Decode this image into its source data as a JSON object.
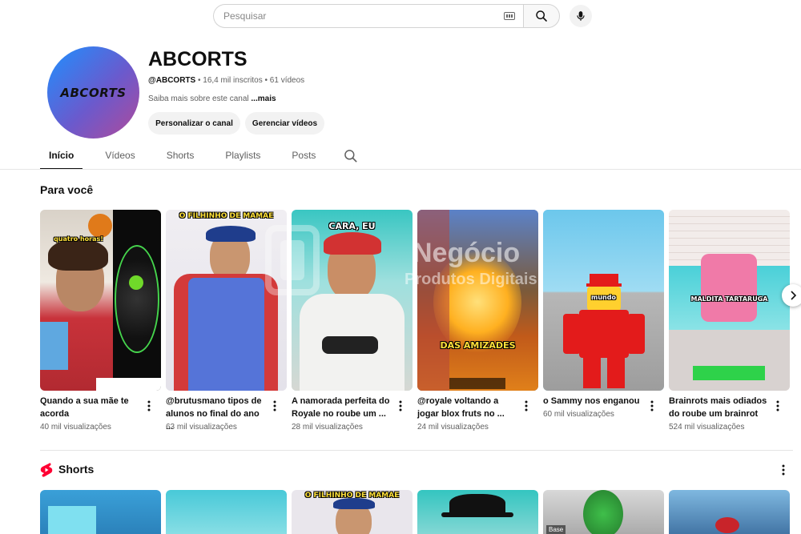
{
  "search": {
    "placeholder": "Pesquisar"
  },
  "channel": {
    "avatar_text": "ABCORTS",
    "name": "ABCORTS",
    "handle": "@ABCORTS",
    "subscribers": "16,4 mil inscritos",
    "videos": "61 vídeos",
    "about": "Saiba mais sobre este canal",
    "about_more": "...mais",
    "customize_label": "Personalizar o canal",
    "manage_label": "Gerenciar vídeos"
  },
  "tabs": [
    {
      "label": "Início",
      "active": true
    },
    {
      "label": "Vídeos",
      "active": false
    },
    {
      "label": "Shorts",
      "active": false
    },
    {
      "label": "Playlists",
      "active": false
    },
    {
      "label": "Posts",
      "active": false
    }
  ],
  "sections": {
    "for_you": "Para você",
    "shorts": "Shorts"
  },
  "videos": [
    {
      "title": "Quando a sua mãe te acorda",
      "views": "40 mil visualizações",
      "caption": "quatro horas!"
    },
    {
      "title": "@brutusmano tipos de alunos no final do ano ...",
      "views": "63 mil visualizações",
      "caption": "O FILHINHO DE MAMAE"
    },
    {
      "title": "A namorada perfeita do Royale no roube um ...",
      "views": "28 mil visualizações",
      "caption": "CARA, EU"
    },
    {
      "title": "@royale voltando a jogar blox fruts no ...",
      "views": "24 mil visualizações",
      "caption": "DAS AMIZADES"
    },
    {
      "title": "o Sammy nos enganou",
      "views": "60 mil visualizações",
      "caption": "mundo"
    },
    {
      "title": "Brainrots mais odiados do roube um brainrot",
      "views": "524 mil visualizações",
      "caption": "MALDITA TARTARUGA"
    }
  ],
  "shorts_preview": [
    {
      "caption": ""
    },
    {
      "caption": ""
    },
    {
      "caption": "O FILHINHO DE MAMAE"
    },
    {
      "caption": ""
    },
    {
      "caption": "Base"
    },
    {
      "caption": ""
    }
  ],
  "watermark": {
    "text": "Negócio",
    "sub": "Produtos Digitais"
  },
  "colors": {
    "shorts_red": "#ff0033",
    "accent_text": "#0f0f0f",
    "secondary_text": "#606060"
  }
}
